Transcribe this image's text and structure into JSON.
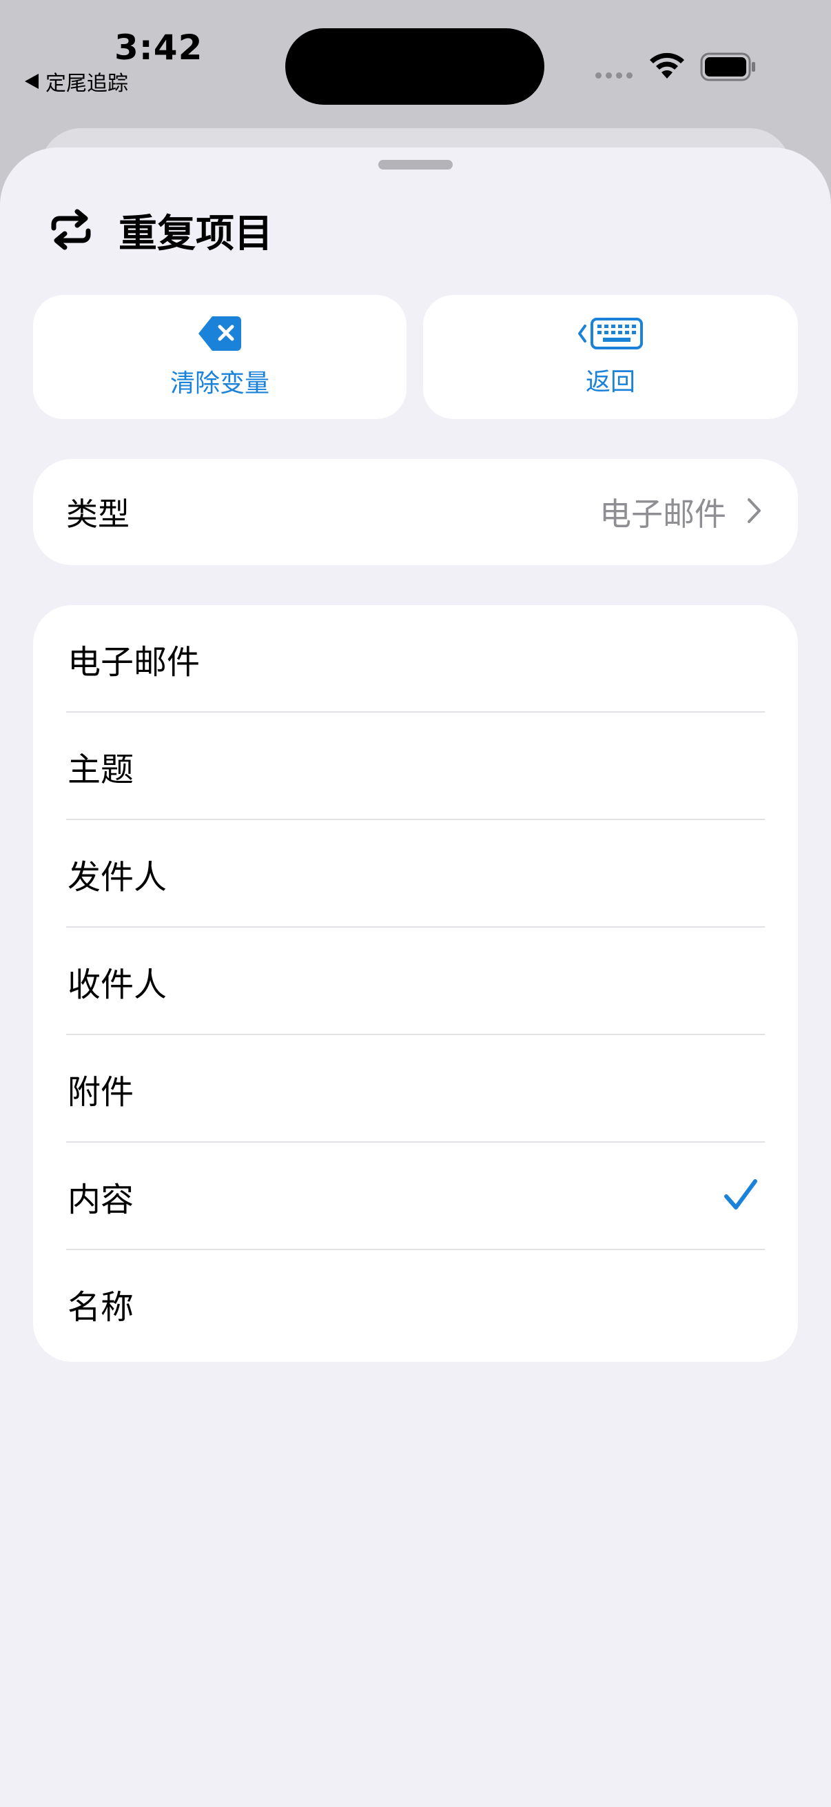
{
  "status_bar": {
    "time": "3:42",
    "back_app": "定尾追踪"
  },
  "sheet": {
    "title": "重复项目",
    "title_icon": "repeat-icon",
    "buttons": {
      "clear_label": "清除变量",
      "clear_icon": "delete-backward-icon",
      "back_label": "返回",
      "back_icon": "keyboard-chevron-left-icon"
    },
    "type_row": {
      "label": "类型",
      "value": "电子邮件"
    },
    "options": [
      {
        "label": "电子邮件",
        "selected": false
      },
      {
        "label": "主题",
        "selected": false
      },
      {
        "label": "发件人",
        "selected": false
      },
      {
        "label": "收件人",
        "selected": false
      },
      {
        "label": "附件",
        "selected": false
      },
      {
        "label": "内容",
        "selected": true
      },
      {
        "label": "名称",
        "selected": false
      }
    ]
  },
  "colors": {
    "accent": "#1a82d8",
    "sheet_bg": "#f1f0f6",
    "card_bg": "#ffffff",
    "secondary_text": "#8e8e93"
  }
}
